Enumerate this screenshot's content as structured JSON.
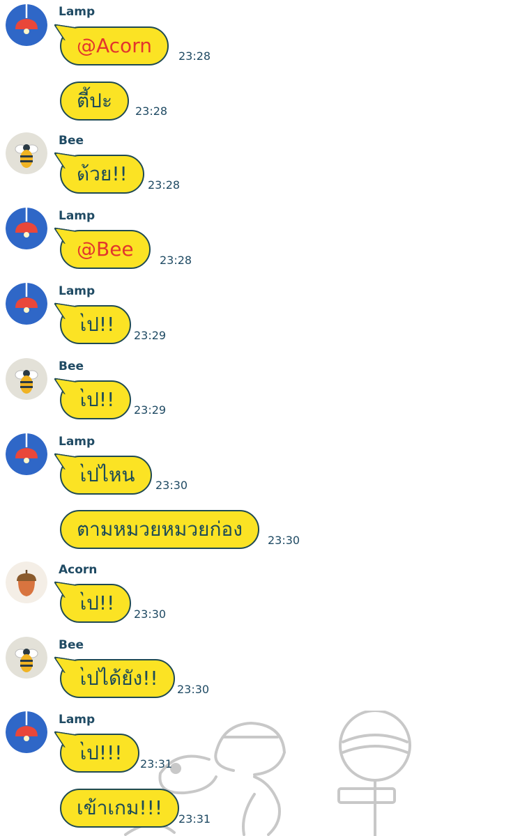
{
  "messages": [
    {
      "sender": "Lamp",
      "avatar": "lamp-icon",
      "text": "@Acorn",
      "mention": true,
      "time": "23:28"
    },
    {
      "sender": "",
      "text": "ตี้ปะ",
      "time": "23:28"
    },
    {
      "sender": "Bee",
      "avatar": "bee-icon",
      "text": "ด้วย!!",
      "time": "23:28"
    },
    {
      "sender": "Lamp",
      "avatar": "lamp-icon",
      "text": "@Bee",
      "mention": true,
      "time": "23:28"
    },
    {
      "sender": "Lamp",
      "avatar": "lamp-icon",
      "text": "ไป!!",
      "time": "23:29"
    },
    {
      "sender": "Bee",
      "avatar": "bee-icon",
      "text": "ไป!!",
      "time": "23:29"
    },
    {
      "sender": "Lamp",
      "avatar": "lamp-icon",
      "text": "ไปไหน",
      "time": "23:30"
    },
    {
      "sender": "",
      "text": "ตามหมวยหมวยก่อง",
      "time": "23:30"
    },
    {
      "sender": "Acorn",
      "avatar": "acorn-icon",
      "text": "ไป!!",
      "time": "23:30"
    },
    {
      "sender": "Bee",
      "avatar": "bee-icon",
      "text": "ไปได้ยัง!!",
      "time": "23:30"
    },
    {
      "sender": "Lamp",
      "avatar": "lamp-icon",
      "text": "ไป!!!",
      "time": "23:31"
    },
    {
      "sender": "",
      "text": "เข้าเกม!!!",
      "time": "23:31"
    }
  ],
  "colors": {
    "bubble": "#fbe324",
    "bubble_border": "#1f4a52",
    "text": "#1d4b57",
    "mention": "#e2352d",
    "sender": "#1f4a63"
  },
  "background_icon": "snoopy-doodle-icon"
}
